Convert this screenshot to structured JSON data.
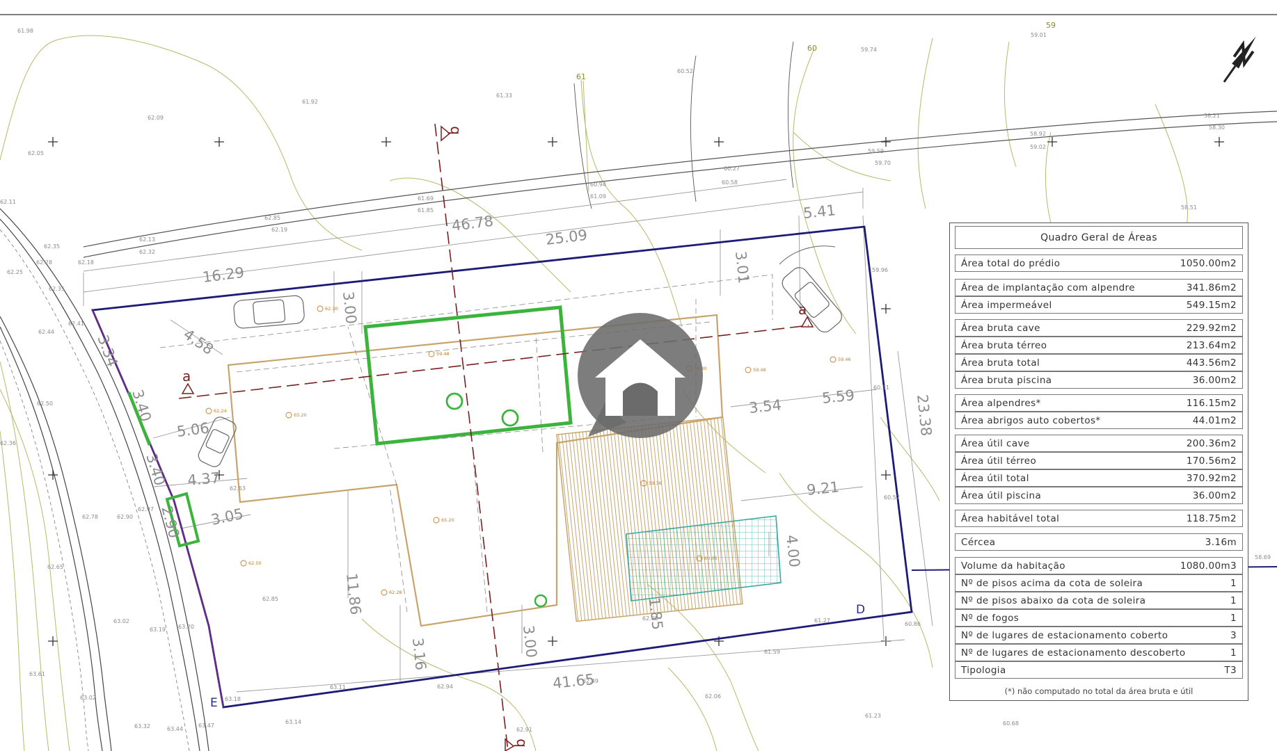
{
  "plan": {
    "dimensions": {
      "d46_78": "46.78",
      "d25_09": "25.09",
      "d16_29": "16.29",
      "d5_41": "5.41",
      "d3_01": "3.01",
      "d3_00a": "3.00",
      "d4_58": "4.58",
      "d3_34": "3.34",
      "d3_40a": "3.40",
      "d5_06": "5.06",
      "d3_40b": "3.40",
      "d4_37": "4.37",
      "d2_90": "2.90",
      "d3_05": "3.05",
      "d11_86": "11.86",
      "d3_16": "3.16",
      "d3_00b": "3.00",
      "d41_65": "41.65",
      "d1_85": "1.85",
      "d4_00": "4.00",
      "d9_21": "9.21",
      "d3_54": "3.54",
      "d5_59": "5.59",
      "d23_38": "23.38"
    },
    "section_labels": {
      "a_left": "a",
      "a_right": "a",
      "b_top": "b",
      "b_bottom": "b"
    },
    "corner_labels": {
      "d": "D",
      "e": "E"
    },
    "contours": {
      "c59": "59",
      "c60": "60",
      "c61": "61"
    },
    "spot_heights": {
      "s61_98": "61.98",
      "s62_09": "62.09",
      "s61_92": "61.92",
      "s61_33": "61.33",
      "s60_52": "60.52",
      "s59_74": "59.74",
      "s59_01": "59.01",
      "s58_21": "58.21",
      "s58_30": "58.30",
      "s58_92": "58.92",
      "s59_02": "59.02",
      "s59_59": "59.59",
      "s59_70": "59.70",
      "s60_27": "60.27",
      "s60_58": "60.58",
      "s60_94": "60.94",
      "s61_09": "61.09",
      "s61_69": "61.69",
      "s61_85": "61.85",
      "s62_05": "62.05",
      "s62_85": "62.85",
      "s62_19": "62.19",
      "s62_13": "62.13",
      "s62_32": "62.32",
      "s62_18": "62.18",
      "s62_35a": "62.35",
      "s62_28": "62.28",
      "s62_25": "62.25",
      "s62_35b": "62.35",
      "s62_41": "62.41",
      "s62_44": "62.44",
      "s62_50": "62.50",
      "s62_36": "62.36",
      "s62_78": "62.78",
      "s62_90": "62.90",
      "s62_97": "62.97",
      "s62_65": "62.65",
      "s63_02": "63.02",
      "s63_19": "63.19",
      "s63_20": "63.20",
      "s63_61": "63.61",
      "s63_02b": "63.02",
      "s63_32": "63.32",
      "s63_44": "63.44",
      "s63_47": "63.47",
      "s63_18": "63.18",
      "s63_14": "63.14",
      "s63_11": "63.11",
      "s62_94": "62.94",
      "s62_91": "62.91",
      "s62_49": "62.49",
      "s62_06": "62.06",
      "s61_59": "61.59",
      "s61_23": "61.23",
      "s60_68": "60.68",
      "s61_27": "61.27",
      "s60_86": "60.86",
      "s60_57": "60.57",
      "s60_31": "60.31",
      "s59_96": "59.96",
      "s58_51": "58.51",
      "s62_63": "62.63",
      "s62_85b": "62.85",
      "s62_11": "62.11",
      "s62_05b": "62.05",
      "s58_69": "58.69"
    },
    "levels": {
      "l62_30": "62.30",
      "l59_48a": "59.48",
      "l59_30": "59.30",
      "l59_48b": "59.48",
      "l59_46": "59.46",
      "l65_20a": "65.20",
      "l62_24": "62.24",
      "l59_36": "59.36",
      "l65_20b": "65.20",
      "l62_50": "62.50",
      "l62_28": "62.28",
      "l60_06": "60.06"
    },
    "colors": {
      "boundary": "#1c1c78",
      "green": "#3cb43c",
      "section": "#7a1f1f",
      "building": "#c8a46a",
      "pool": "#3aa8a0"
    }
  },
  "table": {
    "title": "Quadro Geral de Áreas",
    "rows": [
      {
        "label": "Área total do prédio",
        "value": "1050.00m2"
      },
      {
        "label": "Área de implantação com alpendre",
        "value": "341.86m2"
      },
      {
        "label": "Área impermeável",
        "value": "549.15m2"
      },
      {
        "label": "Área bruta cave",
        "value": "229.92m2"
      },
      {
        "label": "Área bruta térreo",
        "value": "213.64m2"
      },
      {
        "label": "Área bruta total",
        "value": "443.56m2"
      },
      {
        "label": "Área bruta piscina",
        "value": "36.00m2"
      },
      {
        "label": "Área alpendres*",
        "value": "116.15m2"
      },
      {
        "label": "Área abrigos auto cobertos*",
        "value": "44.01m2"
      },
      {
        "label": "Área útil cave",
        "value": "200.36m2"
      },
      {
        "label": "Área útil térreo",
        "value": "170.56m2"
      },
      {
        "label": "Área útil total",
        "value": "370.92m2"
      },
      {
        "label": "Área útil piscina",
        "value": "36.00m2"
      },
      {
        "label": "Área habitável total",
        "value": "118.75m2"
      },
      {
        "label": "Cércea",
        "value": "3.16m"
      },
      {
        "label": "Volume da habitação",
        "value": "1080.00m3"
      },
      {
        "label": "Nº de pisos acima da cota de soleira",
        "value": "1"
      },
      {
        "label": "Nº de pisos abaixo da cota de soleira",
        "value": "1"
      },
      {
        "label": "Nº de fogos",
        "value": "1"
      },
      {
        "label": "Nº de lugares de estacionamento coberto",
        "value": "3"
      },
      {
        "label": "Nº de lugares de estacionamento descoberto",
        "value": "1"
      },
      {
        "label": "Tipologia",
        "value": "T3"
      }
    ],
    "note": "(*) não computado no total da área bruta e útil"
  }
}
